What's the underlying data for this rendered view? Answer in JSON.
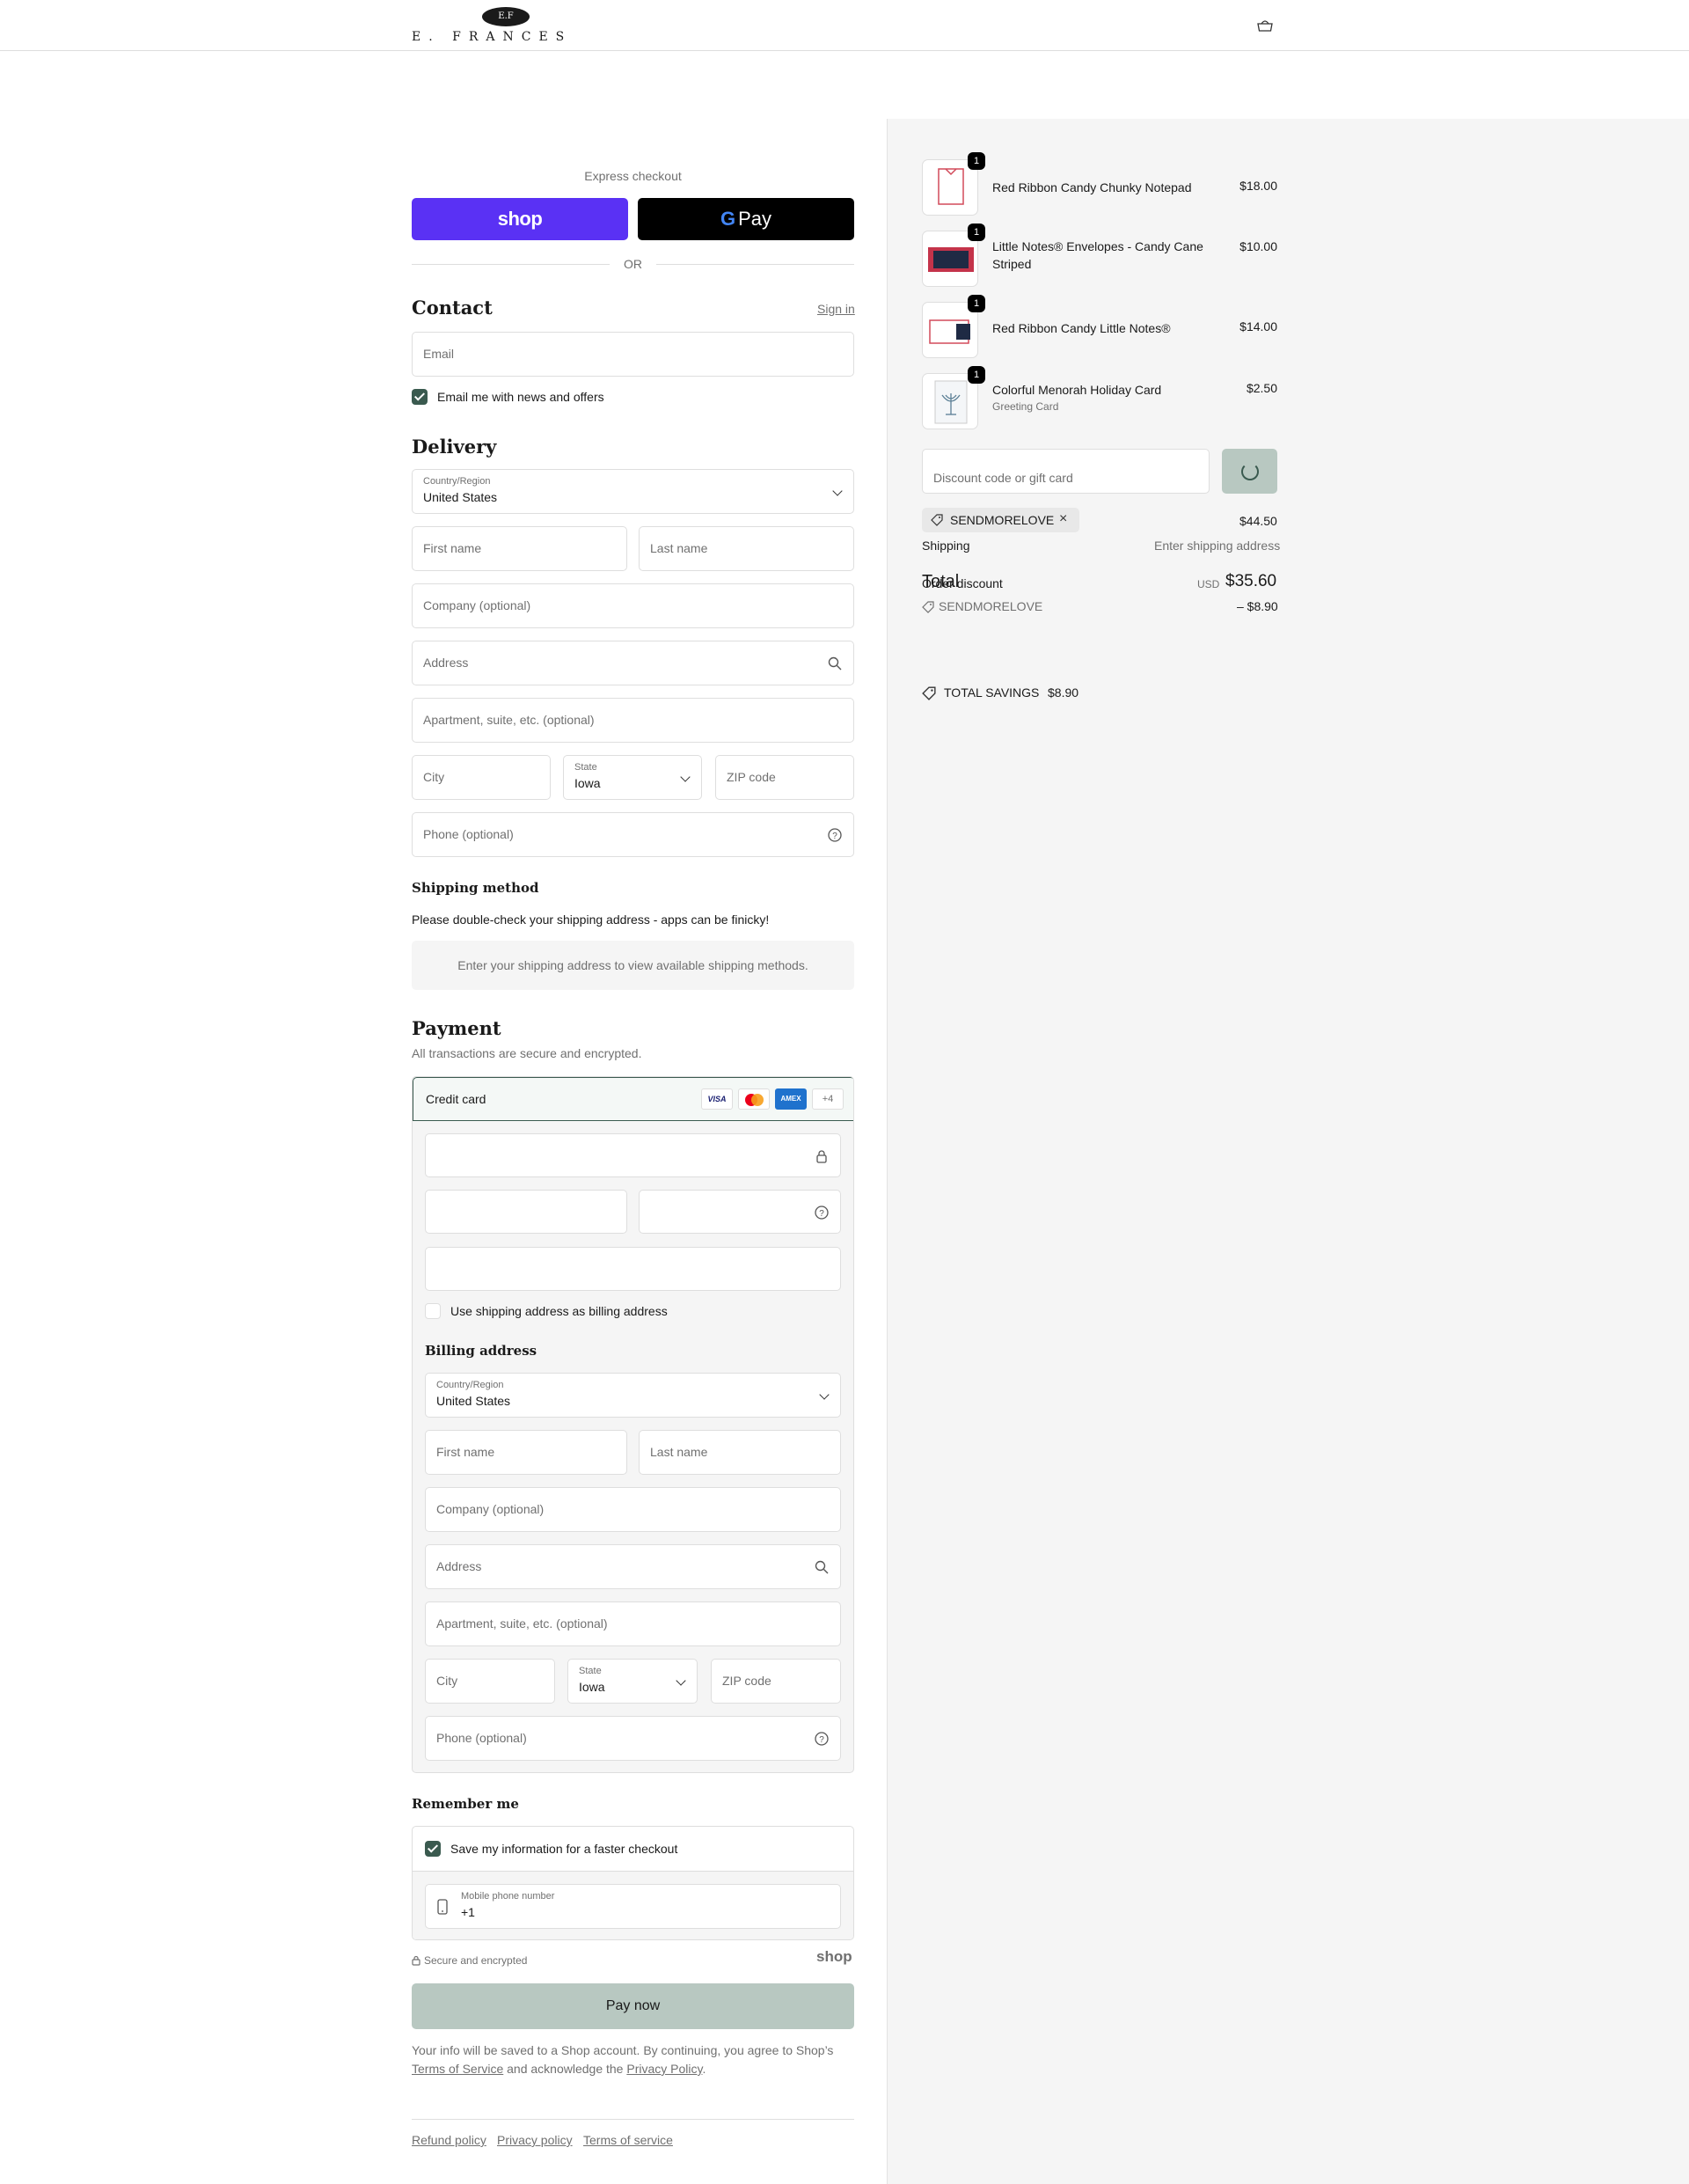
{
  "header": {
    "logo_monogram": "E.F",
    "logo_text": "E. FRANCES",
    "cart_icon": "shopping-bag-icon"
  },
  "express": {
    "label": "Express checkout",
    "shop_button": "shop",
    "gpay_letter": "G",
    "gpay_button": "Pay",
    "or": "OR"
  },
  "contact": {
    "title": "Contact",
    "sign_in": "Sign in",
    "email_placeholder": "Email",
    "newsletter_label": "Email me with news and offers",
    "newsletter_checked": true
  },
  "delivery": {
    "title": "Delivery",
    "country_label": "Country/Region",
    "country_value": "United States",
    "first_name": "First name",
    "last_name": "Last name",
    "company": "Company (optional)",
    "address": "Address",
    "apartment": "Apartment, suite, etc. (optional)",
    "city": "City",
    "state_label": "State",
    "state_value": "Iowa",
    "zip": "ZIP code",
    "phone": "Phone (optional)"
  },
  "shipping": {
    "title": "Shipping method",
    "note": "Please double-check your shipping address - apps can be finicky!",
    "placeholder": "Enter your shipping address to view available shipping methods."
  },
  "payment": {
    "title": "Payment",
    "subtitle": "All transactions are secure and encrypted.",
    "method": "Credit card",
    "cards": [
      "VISA",
      "AMEX"
    ],
    "more_cards": "+4",
    "use_shipping_label": "Use shipping address as billing address",
    "use_shipping_checked": false
  },
  "billing": {
    "title": "Billing address",
    "country_label": "Country/Region",
    "country_value": "United States",
    "first_name": "First name",
    "last_name": "Last name",
    "company": "Company (optional)",
    "address": "Address",
    "apartment": "Apartment, suite, etc. (optional)",
    "city": "City",
    "state_label": "State",
    "state_value": "Iowa",
    "zip": "ZIP code",
    "phone": "Phone (optional)"
  },
  "remember": {
    "title": "Remember me",
    "save_label": "Save my information for a faster checkout",
    "save_checked": true,
    "mobile_label": "Mobile phone number",
    "mobile_value": "+1"
  },
  "footer_area": {
    "secure": "Secure and encrypted",
    "shop_mark": "shop",
    "pay_now": "Pay now",
    "legal_1": "Your info will be saved to a Shop account. By continuing, you agree to Shop’s",
    "terms": "Terms of Service",
    "legal_2": "and acknowledge the",
    "privacy": "Privacy Policy",
    "legal_end": ".",
    "links": [
      "Refund policy",
      "Privacy policy",
      "Terms of service"
    ]
  },
  "order": {
    "items": [
      {
        "name": "Red Ribbon Candy Chunky Notepad",
        "variant": "",
        "price": "$18.00",
        "qty": "1"
      },
      {
        "name": "Little Notes® Envelopes - Candy Cane Striped",
        "variant": "",
        "price": "$10.00",
        "qty": "1"
      },
      {
        "name": "Red Ribbon Candy Little Notes®",
        "variant": "",
        "price": "$14.00",
        "qty": "1"
      },
      {
        "name": "Colorful Menorah Holiday Card",
        "variant": "Greeting Card",
        "price": "$2.50",
        "qty": "1"
      }
    ],
    "discount_placeholder": "Discount code or gift card",
    "applied_code": "SENDMORELOVE",
    "subtotal": "$44.50",
    "shipping_label": "Shipping",
    "shipping_value": "Enter shipping address",
    "total_label": "Total",
    "order_discount_label": "Order discount",
    "currency": "USD",
    "total": "$35.60",
    "discount_code": "SENDMORELOVE",
    "discount_value": "– $8.90",
    "savings_label": "TOTAL SAVINGS",
    "savings_value": "$8.90"
  }
}
